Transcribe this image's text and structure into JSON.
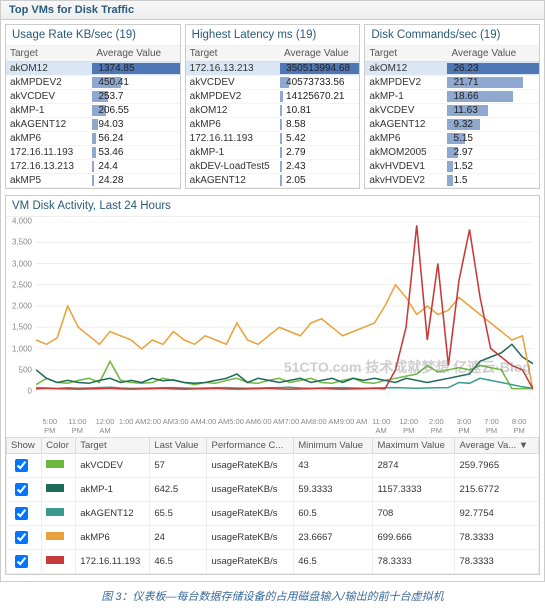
{
  "header": {
    "title": "Top VMs for Disk Traffic"
  },
  "panels": [
    {
      "title": "Usage Rate KB/sec (19)",
      "columns": [
        "Target",
        "Average Value"
      ],
      "max": 1374.85,
      "rows": [
        {
          "target": "akOM12",
          "value": 1374.85,
          "selected": true
        },
        {
          "target": "akMPDEV2",
          "value": 450.41
        },
        {
          "target": "akVCDEV",
          "value": 253.7
        },
        {
          "target": "akMP-1",
          "value": 206.55
        },
        {
          "target": "akAGENT12",
          "value": 94.03
        },
        {
          "target": "akMP6",
          "value": 56.24
        },
        {
          "target": "172.16.11.193",
          "value": 53.46
        },
        {
          "target": "172.16.13.213",
          "value": 24.4
        },
        {
          "target": "akMP5",
          "value": 24.28
        }
      ]
    },
    {
      "title": "Highest Latency ms (19)",
      "columns": [
        "Target",
        "Average Value"
      ],
      "max": 350513994.68,
      "rows": [
        {
          "target": "172.16.13.213",
          "value": 350513994.68,
          "selected": true
        },
        {
          "target": "akVCDEV",
          "value": 40573733.56
        },
        {
          "target": "akMPDEV2",
          "value": 14125670.21
        },
        {
          "target": "akOM12",
          "value": 10.81
        },
        {
          "target": "akMP6",
          "value": 8.58
        },
        {
          "target": "172.16.11.193",
          "value": 5.42
        },
        {
          "target": "akMP-1",
          "value": 2.79
        },
        {
          "target": "akDEV-LoadTest5",
          "value": 2.43
        },
        {
          "target": "akAGENT12",
          "value": 2.05
        }
      ]
    },
    {
      "title": "Disk Commands/sec (19)",
      "columns": [
        "Target",
        "Average Value"
      ],
      "max": 26.23,
      "rows": [
        {
          "target": "akOM12",
          "value": 26.23,
          "selected": true
        },
        {
          "target": "akMPDEV2",
          "value": 21.71
        },
        {
          "target": "akMP-1",
          "value": 18.66
        },
        {
          "target": "akVCDEV",
          "value": 11.63
        },
        {
          "target": "akAGENT12",
          "value": 9.32
        },
        {
          "target": "akMP6",
          "value": 5.15
        },
        {
          "target": "akMOM2005",
          "value": 2.97
        },
        {
          "target": "akvHVDEV1",
          "value": 1.52
        },
        {
          "target": "akvHVDEV2",
          "value": 1.5
        }
      ]
    }
  ],
  "chart": {
    "title": "VM Disk Activity, Last 24 Hours",
    "y_ticks": [
      0,
      500,
      1000,
      1500,
      2000,
      2500,
      3000,
      3500,
      4000
    ],
    "x_labels": [
      "5:00 PM",
      "11:00 PM",
      "12:00 AM",
      "1:00 AM",
      "2:00 AM",
      "3:00 AM",
      "4:00 AM",
      "5:00 AM",
      "6:00 AM",
      "7:00 AM",
      "8:00 AM",
      "9:00 AM",
      "11:00 AM",
      "12:00 PM",
      "2:00 PM",
      "3:00 PM",
      "7:00 PM",
      "8:00 PM"
    ],
    "legend_columns": [
      "Show",
      "Color",
      "Target",
      "Last Value",
      "Performance C...",
      "Minimum Value",
      "Maximum Value",
      "Average Va... ▼"
    ]
  },
  "chart_data": {
    "type": "line",
    "title": "VM Disk Activity, Last 24 Hours",
    "xlabel": "",
    "ylabel": "",
    "ylim": [
      0,
      4000
    ],
    "x_index": [
      0,
      1,
      2,
      3,
      4,
      5,
      6,
      7,
      8,
      9,
      10,
      11,
      12,
      13,
      14,
      15,
      16,
      17,
      18,
      19,
      20,
      21,
      22,
      23,
      24,
      25,
      26,
      27,
      28,
      29,
      30,
      31,
      32,
      33,
      34,
      35,
      36,
      37,
      38,
      39,
      40,
      41,
      42,
      43,
      44,
      45,
      46,
      47
    ],
    "series": [
      {
        "name": "akVCDEV",
        "color": "#6fb83f",
        "values": [
          150,
          300,
          200,
          180,
          250,
          300,
          200,
          700,
          250,
          200,
          180,
          200,
          300,
          250,
          200,
          150,
          200,
          180,
          250,
          300,
          200,
          180,
          250,
          300,
          200,
          250,
          300,
          200,
          180,
          250,
          300,
          200,
          180,
          250,
          300,
          350,
          400,
          600,
          450,
          500,
          550,
          500,
          600,
          550,
          500,
          57,
          57,
          57
        ],
        "show": true,
        "last": 57,
        "perf": "usageRateKB/s",
        "min": 43,
        "max": 2874,
        "avg": 259.7965
      },
      {
        "name": "akMP-1",
        "color": "#1f6b5b",
        "values": [
          500,
          300,
          200,
          250,
          200,
          180,
          250,
          300,
          200,
          250,
          200,
          300,
          240,
          260,
          200,
          180,
          200,
          250,
          300,
          400,
          200,
          300,
          250,
          200,
          250,
          300,
          200,
          250,
          300,
          200,
          300,
          250,
          300,
          250,
          200,
          300,
          250,
          200,
          250,
          300,
          350,
          400,
          700,
          800,
          900,
          1100,
          800,
          642.5
        ],
        "show": true,
        "last": 642.5,
        "perf": "usageRateKB/s",
        "min": 59.3333,
        "max": 1157.3333,
        "avg": 215.6772
      },
      {
        "name": "akAGENT12",
        "color": "#3b9b8c",
        "values": [
          80,
          70,
          60,
          75,
          65,
          70,
          80,
          90,
          70,
          60,
          65,
          70,
          75,
          80,
          70,
          65,
          70,
          75,
          80,
          70,
          65,
          70,
          75,
          80,
          90,
          70,
          65,
          70,
          75,
          80,
          70,
          65,
          70,
          75,
          80,
          70,
          65,
          70,
          75,
          80,
          200,
          180,
          300,
          250,
          200,
          150,
          100,
          65.5
        ],
        "show": true,
        "last": 65.5,
        "perf": "usageRateKB/s",
        "min": 60.5,
        "max": 708,
        "avg": 92.7754
      },
      {
        "name": "akMP6",
        "color": "#e9a23b",
        "values": [
          1200,
          1100,
          1250,
          2000,
          1500,
          1300,
          1100,
          1400,
          1300,
          1200,
          990,
          1200,
          1100,
          1400,
          1200,
          1100,
          1300,
          1200,
          1100,
          1600,
          1200,
          1100,
          1300,
          1500,
          1400,
          1300,
          1600,
          1700,
          1500,
          1300,
          1400,
          1500,
          1600,
          2000,
          2500,
          2200,
          1800,
          2000,
          1800,
          1900,
          2200,
          2000,
          1800,
          1600,
          1400,
          1200,
          1300,
          24
        ],
        "show": true,
        "last": 24,
        "perf": "usageRateKB/s",
        "min": 23.6667,
        "max": 699.666,
        "avg": 78.3333
      },
      {
        "name": "172.16.11.193",
        "color": "#c73a3a",
        "values": [
          50,
          60,
          55,
          50,
          45,
          50,
          55,
          60,
          50,
          45,
          50,
          55,
          60,
          50,
          45,
          50,
          55,
          60,
          50,
          45,
          50,
          55,
          60,
          50,
          45,
          50,
          55,
          60,
          50,
          45,
          50,
          55,
          60,
          50,
          500,
          1500,
          3900,
          1200,
          3000,
          600,
          2600,
          3800,
          2200,
          1000,
          800,
          600,
          500,
          46.5
        ],
        "show": true,
        "last": 46.5,
        "perf": "usageRateKB/s",
        "min": 46.5,
        "max": 78.3333,
        "avg": 78.3333
      }
    ]
  },
  "caption": "图 3：仪表板—每台数据存储设备的占用磁盘输入/输出的前十台虚拟机",
  "watermark": "51CTO.com 技术成就梦想 亿速云·Blog"
}
